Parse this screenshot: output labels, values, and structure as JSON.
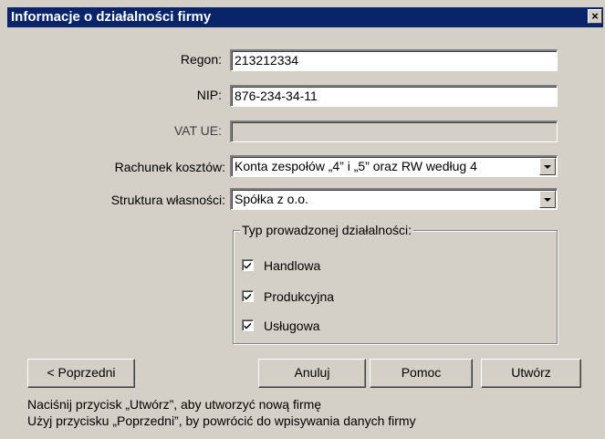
{
  "window": {
    "title": "Informacje o działalności firmy",
    "close_label": "×"
  },
  "form": {
    "regon": {
      "label": "Regon:",
      "value": "213212334"
    },
    "nip": {
      "label": "NIP:",
      "value": "876-234-34-11"
    },
    "vat_ue": {
      "label": "VAT UE:",
      "value": ""
    },
    "rachunek_kosztow": {
      "label": "Rachunek kosztów:",
      "value": "Konta zespołów „4” i „5” oraz RW według 4"
    },
    "struktura_wlasnosci": {
      "label": "Struktura własności:",
      "value": "Spółka z o.o."
    }
  },
  "business_type": {
    "title": "Typ prowadzonej działalności:",
    "options": [
      {
        "label": "Handlowa",
        "checked": true
      },
      {
        "label": "Produkcyjna",
        "checked": true
      },
      {
        "label": "Usługowa",
        "checked": true
      }
    ]
  },
  "buttons": {
    "previous": "< Poprzedni",
    "cancel": "Anuluj",
    "help": "Pomoc",
    "create": "Utwórz"
  },
  "hints": {
    "line1": "Naciśnij przycisk „Utwórz”, aby utworzyć nową firmę",
    "line2": "Użyj przycisku „Poprzedni”, by powrócić do wpisywania danych firmy"
  },
  "icons": {
    "close": "close-icon",
    "dropdown": "chevron-down-icon",
    "check": "checkmark-icon"
  },
  "colors": {
    "titlebar": "#0a246a",
    "dialog_bg": "#d4d0c8"
  }
}
